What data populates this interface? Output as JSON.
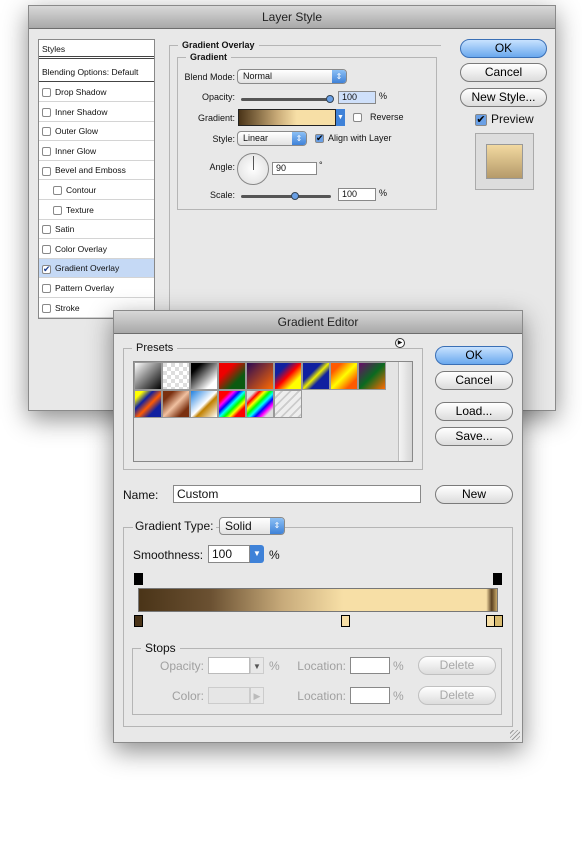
{
  "layer_style": {
    "title": "Layer Style",
    "styles_header": "Styles",
    "blending_options": "Blending Options: Default",
    "items": [
      {
        "label": "Drop Shadow",
        "checked": false,
        "indent": false
      },
      {
        "label": "Inner Shadow",
        "checked": false,
        "indent": false
      },
      {
        "label": "Outer Glow",
        "checked": false,
        "indent": false
      },
      {
        "label": "Inner Glow",
        "checked": false,
        "indent": false
      },
      {
        "label": "Bevel and Emboss",
        "checked": false,
        "indent": false
      },
      {
        "label": "Contour",
        "checked": false,
        "indent": true
      },
      {
        "label": "Texture",
        "checked": false,
        "indent": true
      },
      {
        "label": "Satin",
        "checked": false,
        "indent": false
      },
      {
        "label": "Color Overlay",
        "checked": false,
        "indent": false
      },
      {
        "label": "Gradient Overlay",
        "checked": true,
        "indent": false,
        "selected": true
      },
      {
        "label": "Pattern Overlay",
        "checked": false,
        "indent": false
      },
      {
        "label": "Stroke",
        "checked": false,
        "indent": false
      }
    ],
    "section_title": "Gradient Overlay",
    "group_title": "Gradient",
    "blend_mode_label": "Blend Mode:",
    "blend_mode": "Normal",
    "opacity_label": "Opacity:",
    "opacity": "100",
    "opacity_unit": "%",
    "opacity_value": 100,
    "gradient_label": "Gradient:",
    "reverse_label": "Reverse",
    "reverse": false,
    "style_label": "Style:",
    "style": "Linear",
    "align_label": "Align with Layer",
    "align": true,
    "angle_label": "Angle:",
    "angle": "90",
    "angle_unit": "°",
    "scale_label": "Scale:",
    "scale": "100",
    "scale_unit": "%",
    "scale_value": 100,
    "ok": "OK",
    "cancel": "Cancel",
    "new_style": "New Style...",
    "preview_label": "Preview",
    "preview": true
  },
  "gradient_editor": {
    "title": "Gradient Editor",
    "presets_label": "Presets",
    "ok": "OK",
    "cancel": "Cancel",
    "load": "Load...",
    "save": "Save...",
    "name_label": "Name:",
    "name": "Custom",
    "new": "New",
    "type_label": "Gradient Type:",
    "type": "Solid",
    "smoothness_label": "Smoothness:",
    "smoothness": "100",
    "smoothness_unit": "%",
    "stops_label": "Stops",
    "opacity_label": "Opacity:",
    "opacity_unit": "%",
    "color_label": "Color:",
    "location_label": "Location:",
    "location_unit": "%",
    "delete": "Delete",
    "colors": {
      "dark": "#4a3418",
      "light": "#f7dfa6",
      "accent": "#5a9be8"
    }
  }
}
